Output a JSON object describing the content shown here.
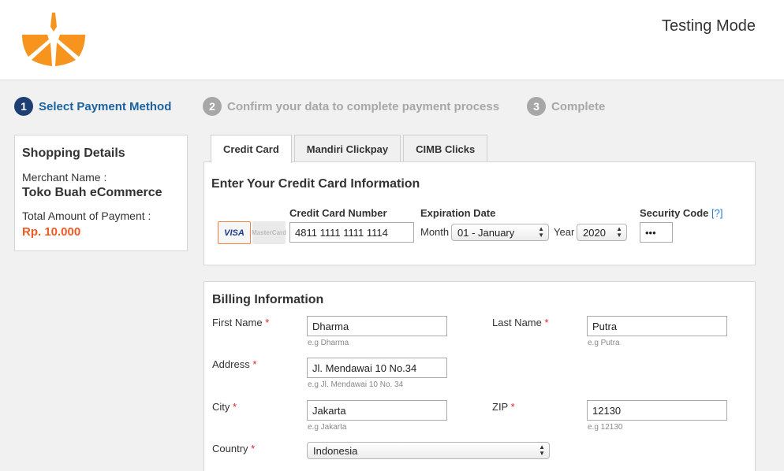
{
  "header": {
    "mode_label": "Testing Mode",
    "brand_color": "#f7941d"
  },
  "steps": [
    {
      "number": "1",
      "label": "Select Payment Method",
      "state": "active"
    },
    {
      "number": "2",
      "label": "Confirm your data to complete payment process",
      "state": "inactive"
    },
    {
      "number": "3",
      "label": "Complete",
      "state": "inactive"
    }
  ],
  "shopping": {
    "title": "Shopping Details",
    "merchant_label": "Merchant Name :",
    "merchant_name": "Toko Buah eCommerce",
    "amount_label": "Total Amount of Payment :",
    "amount": "Rp. 10.000"
  },
  "tabs": [
    {
      "label": "Credit Card",
      "active": true
    },
    {
      "label": "Mandiri Clickpay",
      "active": false
    },
    {
      "label": "CIMB Clicks",
      "active": false
    }
  ],
  "credit_card": {
    "title": "Enter Your Credit Card Information",
    "visa_label": "VISA",
    "mastercard_label": "MasterCard",
    "number_label": "Credit Card Number",
    "number_value": "4811 1111 1111 1114",
    "expiration_label": "Expiration Date",
    "month_label": "Month",
    "month_value": "01 - January",
    "year_label": "Year",
    "year_value": "2020",
    "security_label": "Security Code",
    "security_help": "[?]",
    "security_value": "•••"
  },
  "billing": {
    "title": "Billing Information",
    "required_mark": "*",
    "first_name_label": "First Name",
    "first_name_value": "Dharma",
    "first_name_hint": "e.g Dharma",
    "last_name_label": "Last Name",
    "last_name_value": "Putra",
    "last_name_hint": "e.g Putra",
    "address_label": "Address",
    "address_value": "Jl. Mendawai 10 No.34",
    "address_hint": "e.g Jl. Mendawai 10 No. 34",
    "city_label": "City",
    "city_value": "Jakarta",
    "city_hint": "e.g Jakarta",
    "zip_label": "ZIP",
    "zip_value": "12130",
    "zip_hint": "e.g 12130",
    "country_label": "Country",
    "country_value": "Indonesia"
  }
}
